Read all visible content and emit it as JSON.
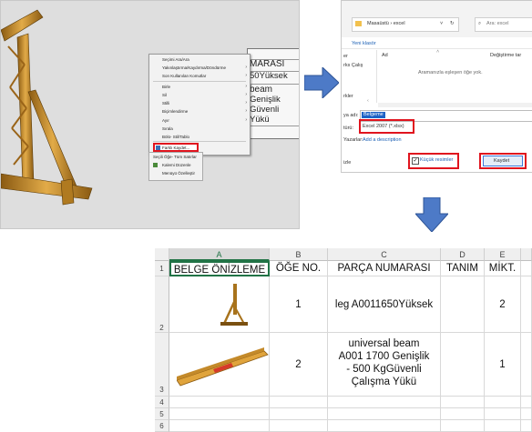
{
  "cad": {
    "bom_rows": [
      "",
      "MARASI",
      "50Yüksek",
      "beam",
      "Genişlik",
      "Güvenli",
      "Yükü"
    ],
    "context_menu": {
      "items": [
        "Seçimi Ara/Ara",
        "Yakınlaştırma/Kaydırma/Döndürme",
        "Son Kullanılan Komutlar",
        "Birle",
        "Sil",
        "Stilli",
        "Biçimlendirme",
        "Ayır",
        "Sırala",
        "Bölü- Stil/Tablo",
        "Farklı Kaydet..."
      ],
      "submenu": [
        "Seçili Öğe- Tüm Satırlar",
        "Kalemi Düzenle",
        "Menüyü Özelleştir"
      ]
    }
  },
  "dialog": {
    "breadcrumb": "Masaüstü  ›  excel",
    "search_placeholder": "Ara: excel",
    "new_folder": "Yeni klasör",
    "col_name": "Ad",
    "col_modified": "Değiştirme tar",
    "sidebar": [
      "er",
      "rks Çalış",
      "rkler"
    ],
    "empty_msg": "Aramanızla eşleşen öğe yok.",
    "filename_label": "ya adı:",
    "filename_value": "Belgeme",
    "type_label": "türü:",
    "type_value": "Excel 2007 (*.xlsx)",
    "authors_label": "Yazarlar:",
    "authors_value": "Add a description",
    "hide_label": "izle",
    "thumbnail_label": "Küçük resimler",
    "thumbnail_checked": true,
    "save_button": "Kaydet"
  },
  "excel": {
    "columns": [
      "A",
      "B",
      "C",
      "D",
      "E"
    ],
    "rows": [
      "1",
      "2",
      "3",
      "4",
      "5",
      "6"
    ],
    "headers": [
      "BELGE ÖNİZLEME",
      "ÖĞE NO.",
      "PARÇA NUMARASI",
      "TANIM",
      "MİKT."
    ],
    "data": [
      {
        "item_no": "1",
        "part_no": "leg A0011650Yüksek",
        "qty": "2"
      },
      {
        "item_no": "2",
        "part_no_lines": [
          "universal beam",
          "A001  1700  Genişlik",
          "-  500 KgGüvenli",
          "Çalışma Yükü"
        ],
        "qty": "1"
      }
    ]
  },
  "colors": {
    "wood": "#c08a28",
    "red_frame": "#e0141e",
    "arrow_blue": "#4d7ac7",
    "excel_green": "#217346"
  }
}
